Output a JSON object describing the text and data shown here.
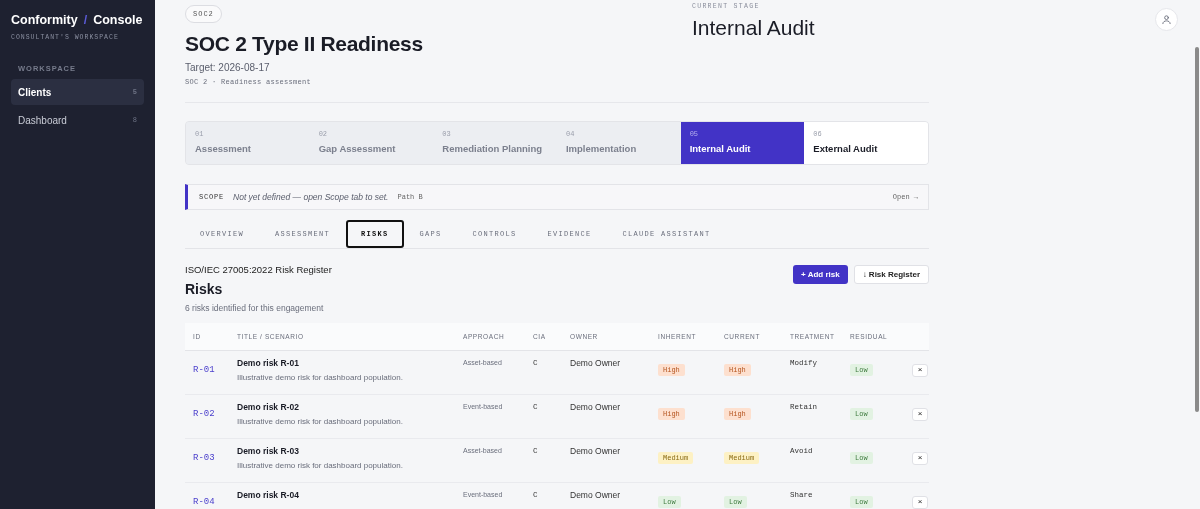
{
  "sidebar": {
    "brand": {
      "left": "Conformity",
      "separator": "/",
      "right": "Console"
    },
    "subtitle": "CONSULTANT'S WORKSPACE",
    "section": "WORKSPACE",
    "items": [
      {
        "label": "Clients",
        "count": "5",
        "selected": true
      },
      {
        "label": "Dashboard",
        "count": "8",
        "selected": false
      }
    ]
  },
  "header": {
    "badge": "SOC2",
    "title": "SOC 2 Type II Readiness",
    "target": "Target: 2026-08-17",
    "meta": "SOC 2 · Readiness assessment",
    "stage_label": "CURRENT STAGE",
    "stage_value": "Internal Audit"
  },
  "stages": [
    {
      "number": "01",
      "label": "Assessment",
      "selected": false,
      "completed": true
    },
    {
      "number": "02",
      "label": "Gap Assessment",
      "selected": false,
      "completed": true
    },
    {
      "number": "03",
      "label": "Remediation Planning",
      "selected": false,
      "completed": true
    },
    {
      "number": "04",
      "label": "Implementation",
      "selected": false,
      "completed": true
    },
    {
      "number": "05",
      "label": "Internal Audit",
      "selected": true,
      "completed": false
    },
    {
      "number": "06",
      "label": "External Audit",
      "selected": false,
      "completed": false
    }
  ],
  "scope": {
    "label": "SCOPE",
    "text": "Not yet defined — open Scope tab to set.",
    "path": "Path B",
    "action": "Open →"
  },
  "tabs": [
    {
      "label": "OVERVIEW",
      "selected": false
    },
    {
      "label": "ASSESSMENT",
      "selected": false
    },
    {
      "label": "RISKS",
      "selected": true
    },
    {
      "label": "GAPS",
      "selected": false
    },
    {
      "label": "CONTROLS",
      "selected": false
    },
    {
      "label": "EVIDENCE",
      "selected": false
    },
    {
      "label": "CLAUDE ASSISTANT",
      "selected": false
    }
  ],
  "register": {
    "framework": "ISO/IEC 27005:2022 Risk Register",
    "title": "Risks",
    "summary": "6 risks identified for this engagement",
    "add_button": "+ Add risk",
    "export_button": "↓ Risk Register"
  },
  "table": {
    "columns": [
      "ID",
      "TITLE / SCENARIO",
      "APPROACH",
      "CIA",
      "OWNER",
      "INHERENT",
      "CURRENT",
      "TREATMENT",
      "RESIDUAL"
    ],
    "rows": [
      {
        "id": "R-01",
        "title": "Demo risk R-01",
        "description": "Illustrative demo risk for dashboard population.",
        "approach": "Asset-based",
        "cia": "C",
        "owner": "Demo Owner",
        "inherent": {
          "text": "High",
          "kind": "high"
        },
        "current": {
          "text": "High",
          "kind": "high"
        },
        "treatment": "Modify",
        "residual": {
          "text": "Low",
          "kind": "low"
        },
        "remove": "×"
      },
      {
        "id": "R-02",
        "title": "Demo risk R-02",
        "description": "Illustrative demo risk for dashboard population.",
        "approach": "Event-based",
        "cia": "C",
        "owner": "Demo Owner",
        "inherent": {
          "text": "High",
          "kind": "high"
        },
        "current": {
          "text": "High",
          "kind": "high"
        },
        "treatment": "Retain",
        "residual": {
          "text": "Low",
          "kind": "low"
        },
        "remove": "×"
      },
      {
        "id": "R-03",
        "title": "Demo risk R-03",
        "description": "Illustrative demo risk for dashboard population.",
        "approach": "Asset-based",
        "cia": "C",
        "owner": "Demo Owner",
        "inherent": {
          "text": "Medium",
          "kind": "medium"
        },
        "current": {
          "text": "Medium",
          "kind": "medium"
        },
        "treatment": "Avoid",
        "residual": {
          "text": "Low",
          "kind": "low"
        },
        "remove": "×"
      },
      {
        "id": "R-04",
        "title": "Demo risk R-04",
        "approach": "Event-based",
        "cia": "C",
        "owner": "Demo Owner",
        "inherent": {
          "text": "Low",
          "kind": "low"
        },
        "current": {
          "text": "Low",
          "kind": "low"
        },
        "treatment": "Share",
        "residual": {
          "text": "Low",
          "kind": "low"
        },
        "remove": "×"
      }
    ]
  }
}
